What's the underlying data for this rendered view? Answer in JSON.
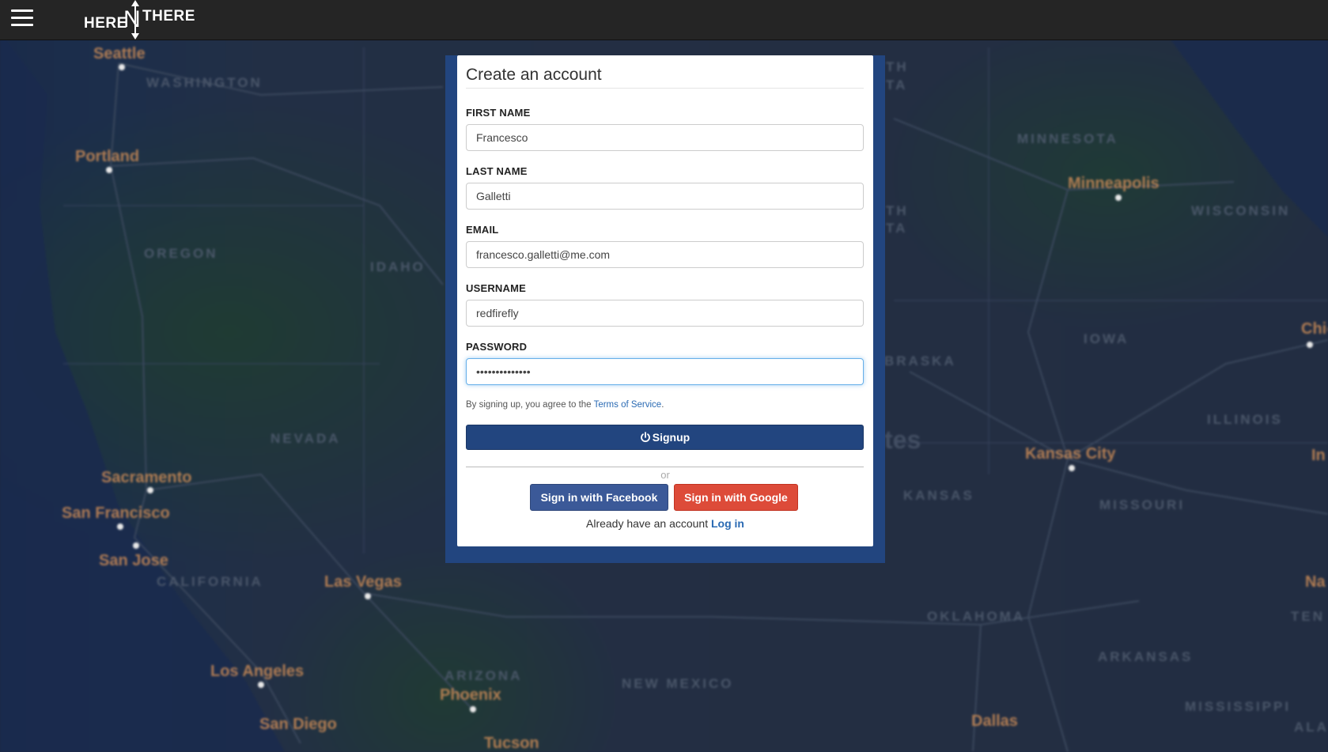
{
  "navbar": {
    "logo": {
      "here": "HERE",
      "n": "N",
      "there": "THERE"
    }
  },
  "map": {
    "labels": {
      "seattle": "Seattle",
      "washington": "WASHINGTON",
      "portland": "Portland",
      "oregon": "OREGON",
      "idaho": "IDAHO",
      "nevada": "NEVADA",
      "sacramento": "Sacramento",
      "san_francisco": "San Francisco",
      "san_jose": "San Jose",
      "california": "CALIFORNIA",
      "las_vegas": "Las Vegas",
      "los_angeles": "Los Angeles",
      "san_diego": "San Diego",
      "arizona": "ARIZONA",
      "phoenix": "Phoenix",
      "tucson": "Tucson",
      "new_mexico": "NEW MEXICO",
      "minnesota": "MINNESOTA",
      "minneapolis": "Minneapolis",
      "wisconsin": "WISCONSIN",
      "iowa": "IOWA",
      "chicago": "Chicag",
      "illinois": "ILLINOIS",
      "kansas_city": "Kansas City",
      "kansas": "KANSAS",
      "missouri": "MISSOURI",
      "oklahoma": "OKLAHOMA",
      "arkansas": "ARKANSAS",
      "mississippi": "MISSISSIPPI",
      "dallas": "Dallas",
      "nebraska": "BRASKA",
      "dakota_n1": "TH",
      "dakota_n2": "TA",
      "dakota_s1": "TH",
      "dakota_s2": "TA",
      "states": "tes",
      "nash": "Na",
      "tenn": "TEN",
      "ind": "In",
      "ala": "ALA"
    }
  },
  "form": {
    "title": "Create an account",
    "first_name": {
      "label": "FIRST NAME",
      "value": "Francesco"
    },
    "last_name": {
      "label": "LAST NAME",
      "value": "Galletti"
    },
    "email": {
      "label": "EMAIL",
      "value": "francesco.galletti@me.com"
    },
    "username": {
      "label": "USERNAME",
      "value": "redfirefly"
    },
    "password": {
      "label": "PASSWORD",
      "value": "••••••••••••••"
    },
    "terms_prefix": "By signing up, you agree to the",
    "terms_link": "Terms of Service",
    "terms_suffix": ".",
    "signup_label": "Signup",
    "or_text": "or",
    "facebook_label": "Sign in with Facebook",
    "google_label": "Sign in with Google",
    "login_prefix": "Already have an account",
    "login_link": "Log in"
  },
  "colors": {
    "navbar": "#252525",
    "primary": "#22457f",
    "facebook": "#3b5998",
    "google": "#dd4b39",
    "link": "#2a6ab3"
  }
}
